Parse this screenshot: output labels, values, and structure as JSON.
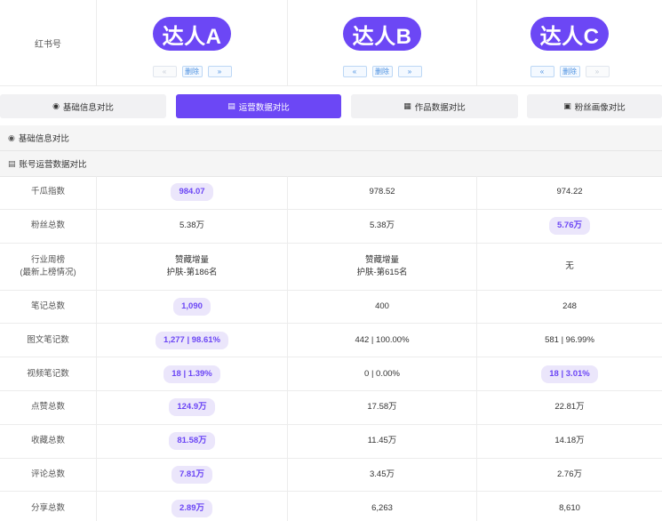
{
  "header": {
    "label": "红书号",
    "influencers": [
      {
        "name": "达人A",
        "prev": "«",
        "delete": "删除",
        "next": "»",
        "prev_disabled": true,
        "next_disabled": false
      },
      {
        "name": "达人B",
        "prev": "«",
        "delete": "删除",
        "next": "»",
        "prev_disabled": false,
        "next_disabled": false
      },
      {
        "name": "达人C",
        "prev": "«",
        "delete": "删除",
        "next": "»",
        "prev_disabled": false,
        "next_disabled": true
      }
    ]
  },
  "tabs": [
    {
      "label": "基础信息对比",
      "icon": "user-circle-icon",
      "active": false
    },
    {
      "label": "运营数据对比",
      "icon": "clipboard-icon",
      "active": true
    },
    {
      "label": "作品数据对比",
      "icon": "document-icon",
      "active": false
    },
    {
      "label": "粉丝画像对比",
      "icon": "profile-card-icon",
      "active": false
    }
  ],
  "sections": {
    "basic": "基础信息对比",
    "operations": "账号运营数据对比"
  },
  "accent_color": "#6c47f5",
  "rows": [
    {
      "metric": "千瓜指数",
      "values": [
        "984.07",
        "978.52",
        "974.22"
      ],
      "highlight": [
        true,
        false,
        false
      ]
    },
    {
      "metric": "粉丝总数",
      "values": [
        "5.38万",
        "5.38万",
        "5.76万"
      ],
      "highlight": [
        false,
        false,
        true
      ]
    },
    {
      "metric": "行业周榜",
      "metric2": "(最新上榜情况)",
      "values": [
        [
          "赞藏增量",
          "护肤-第186名"
        ],
        [
          "赞藏增量",
          "护肤-第615名"
        ],
        [
          "无"
        ]
      ],
      "highlight": [
        false,
        false,
        false
      ]
    },
    {
      "metric": "笔记总数",
      "values": [
        "1,090",
        "400",
        "248"
      ],
      "highlight": [
        true,
        false,
        false
      ]
    },
    {
      "metric": "图文笔记数",
      "values": [
        "1,277 | 98.61%",
        "442 | 100.00%",
        "581 | 96.99%"
      ],
      "highlight": [
        true,
        false,
        false
      ]
    },
    {
      "metric": "视频笔记数",
      "values": [
        "18 | 1.39%",
        "0 | 0.00%",
        "18 | 3.01%"
      ],
      "highlight": [
        true,
        false,
        true
      ]
    },
    {
      "metric": "点赞总数",
      "values": [
        "124.9万",
        "17.58万",
        "22.81万"
      ],
      "highlight": [
        true,
        false,
        false
      ]
    },
    {
      "metric": "收藏总数",
      "values": [
        "81.58万",
        "11.45万",
        "14.18万"
      ],
      "highlight": [
        true,
        false,
        false
      ]
    },
    {
      "metric": "评论总数",
      "values": [
        "7.81万",
        "3.45万",
        "2.76万"
      ],
      "highlight": [
        true,
        false,
        false
      ]
    },
    {
      "metric": "分享总数",
      "values": [
        "2.89万",
        "6,263",
        "8,610"
      ],
      "highlight": [
        true,
        false,
        false
      ]
    }
  ]
}
